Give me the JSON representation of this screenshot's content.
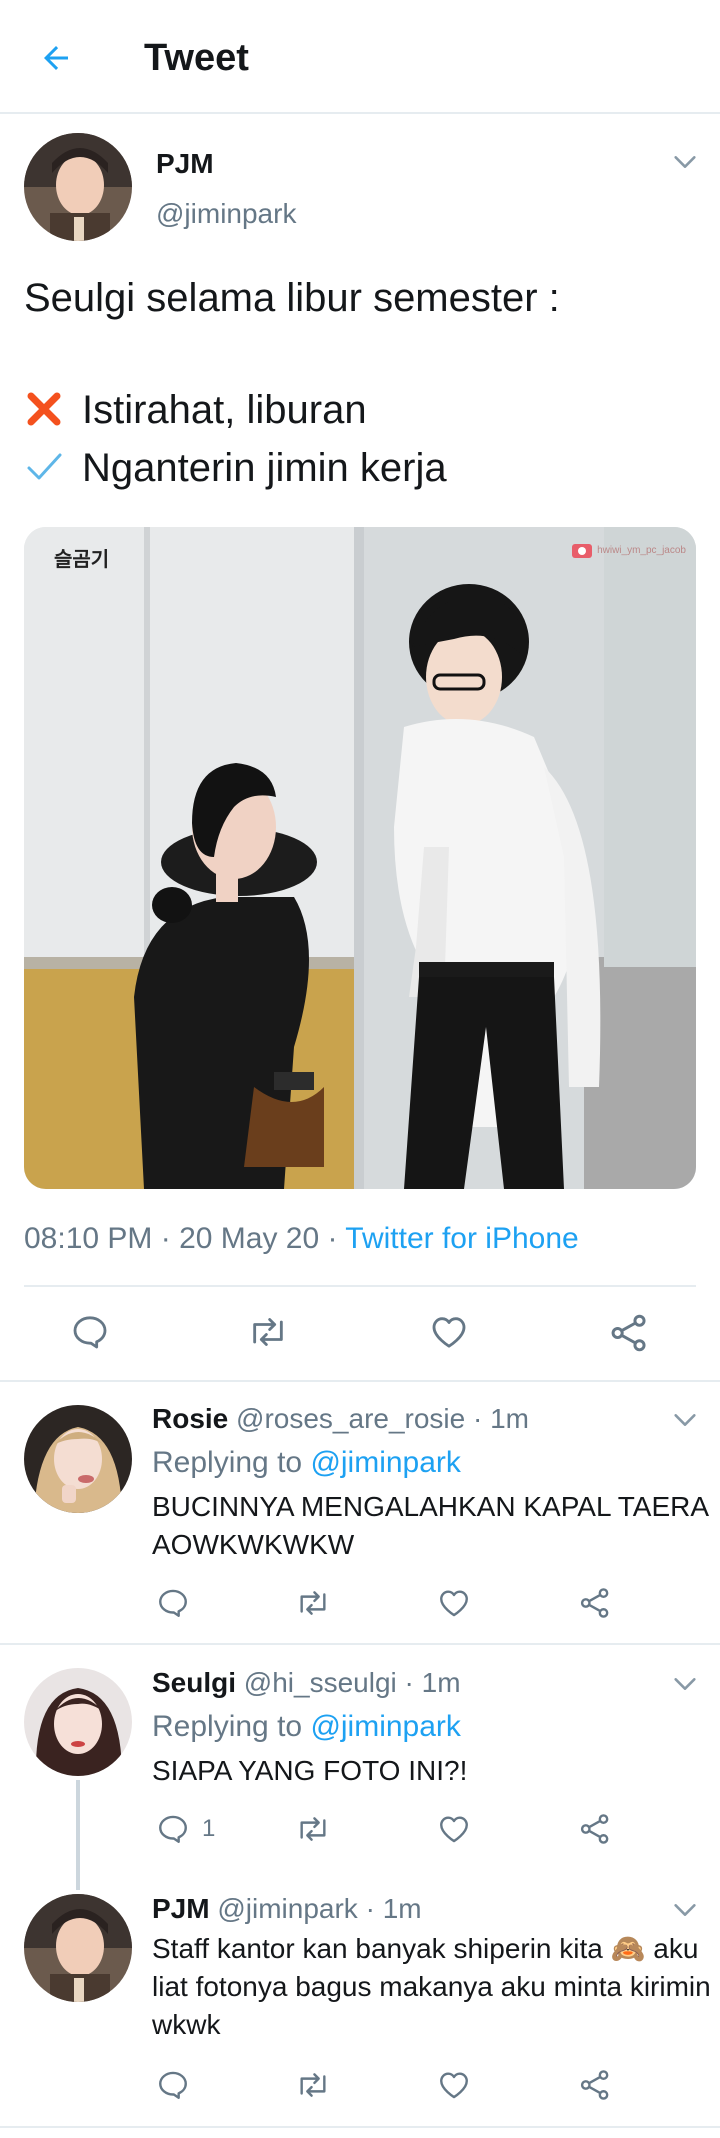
{
  "header": {
    "title": "Tweet"
  },
  "tweet": {
    "author_name": "PJM",
    "author_handle": "@jiminpark",
    "text_line1": "Seulgi selama libur semester :",
    "list": [
      {
        "icon": "x-mark-icon",
        "text": "Istirahat, liburan"
      },
      {
        "icon": "check-mark-icon",
        "text": "Nganterin jimin kerja"
      }
    ],
    "photo": {
      "watermark": "슬곰기",
      "credit": "hwiwi_ym_pc_jacob"
    },
    "timestamp": "08:10 PM · 20 May 20 · ",
    "source": "Twitter for iPhone"
  },
  "replies": [
    {
      "name": "Rosie",
      "handle": "@roses_are_rosie · 1m",
      "replying_prefix": "Replying to ",
      "replying_to": "@jiminpark",
      "text": "BUCINNYA MENGALAHKAN KAPAL TAERA AOWKWKWKW",
      "reply_count": ""
    },
    {
      "name": "Seulgi",
      "handle": "@hi_sseulgi · 1m",
      "replying_prefix": "Replying to ",
      "replying_to": "@jiminpark",
      "text": "SIAPA YANG FOTO INI?!",
      "reply_count": "1"
    },
    {
      "name": "PJM",
      "handle": "@jiminpark · 1m",
      "text": "Staff kantor kan banyak shiperin kita 🙈 aku liat fotonya bagus makanya aku minta kirimin wkwk",
      "reply_count": ""
    }
  ],
  "colors": {
    "accent": "#1da1f2",
    "text": "#14171a",
    "muted": "#657786",
    "divider": "#e6ecf0",
    "icon": "#657786",
    "x_mark": "#f4511e"
  }
}
